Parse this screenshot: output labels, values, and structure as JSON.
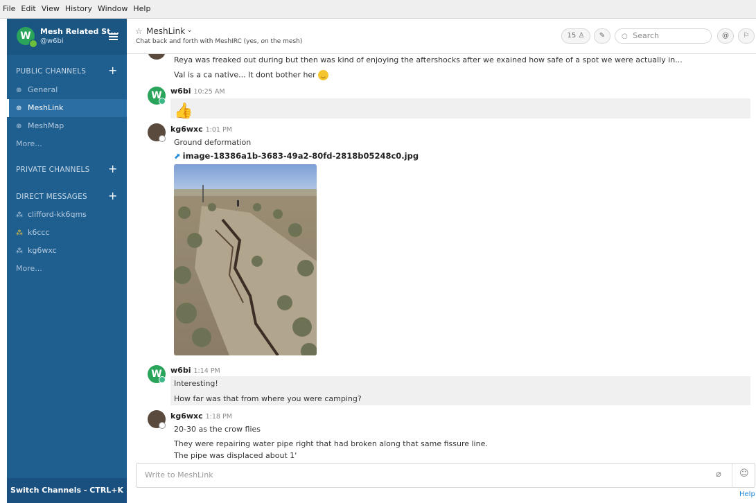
{
  "menubar": [
    "File",
    "Edit",
    "View",
    "History",
    "Window",
    "Help"
  ],
  "team": {
    "initial": "W",
    "name": "Mesh Related St...",
    "user": "@w6bi"
  },
  "sidebar": {
    "public": {
      "title": "PUBLIC CHANNELS",
      "items": [
        "General",
        "MeshLink",
        "MeshMap"
      ],
      "more": "More..."
    },
    "private": {
      "title": "PRIVATE CHANNELS"
    },
    "direct": {
      "title": "DIRECT MESSAGES",
      "items": [
        "clifford-kk6qms",
        "k6ccc",
        "kg6wxc"
      ],
      "more": "More..."
    },
    "switch": "Switch Channels - CTRL+K"
  },
  "header": {
    "channel": "MeshLink",
    "purpose_before": "Chat back and forth with MeshIRC (yes, ",
    "purpose_em": "on",
    "purpose_after": " the mesh)",
    "members": "15",
    "search_placeholder": "Search"
  },
  "posts": [
    {
      "user": "",
      "time": "",
      "lines": [
        "Reya was freaked out during but then was kind of enjoying the aftershocks after we exained how safe of a spot we were actually in...",
        "Val is a ca native... It dont bother her"
      ]
    },
    {
      "user": "w6bi",
      "time": "10:25 AM",
      "emoji": "thumbs-up"
    },
    {
      "user": "kg6wxc",
      "time": "1:01 PM",
      "lines": [
        "Ground deformation"
      ],
      "file": "image-18386a1b-3683-49a2-80fd-2818b05248c0.jpg"
    },
    {
      "user": "w6bi",
      "time": "1:14 PM",
      "lines": [
        "Interesting!",
        "How far was that from where you were camping?"
      ]
    },
    {
      "user": "kg6wxc",
      "time": "1:18 PM",
      "lines": [
        "20-30 as the crow flies",
        "They were repairing water pipe right that had broken along that same fissure line.",
        "The pipe was displaced about 1'"
      ]
    }
  ],
  "composer": {
    "placeholder": "Write to MeshLink"
  },
  "footer": {
    "help": "Help"
  },
  "colors": {
    "sidebar": "#1f5f8f",
    "accent": "#2389d7",
    "online": "#3db887"
  }
}
